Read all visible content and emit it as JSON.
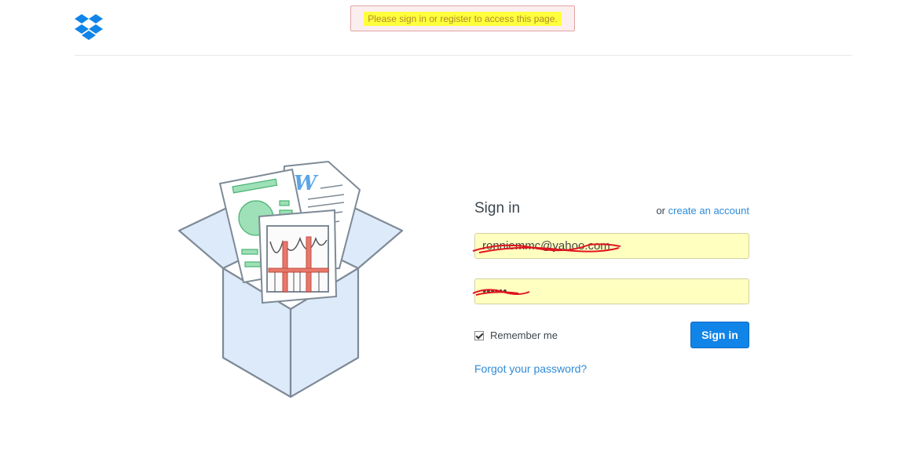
{
  "brand": {
    "logo_icon": "dropbox-logo-icon",
    "color": "#1184e8"
  },
  "notice": {
    "text": "Please sign in or register to access this page."
  },
  "illustration": {
    "icon": "open-box-with-documents-icon",
    "doc_letter": "W"
  },
  "signin": {
    "title": "Sign in",
    "alt_prefix": "or",
    "alt_link": "create an account",
    "email_value": "ronniemmc@yahoo.com",
    "password_value": "••••••",
    "remember_label": "Remember me",
    "remember_checked": true,
    "button_label": "Sign in",
    "forgot_link": "Forgot your password?"
  },
  "colors": {
    "link": "#2e8bd8",
    "field_bg": "#ffffc0",
    "highlight": "#ffff3b",
    "redaction": "#e0141e"
  }
}
